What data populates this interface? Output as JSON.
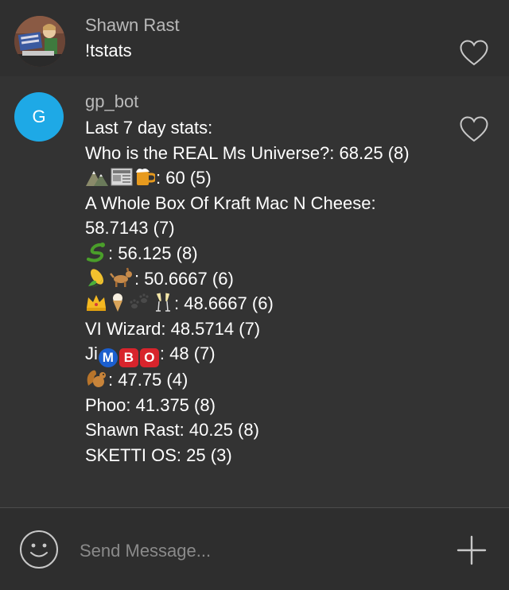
{
  "messages": [
    {
      "sender": "Shawn Rast",
      "lines": [
        "!tstats"
      ],
      "avatar": "photo-avatar",
      "liked": false
    },
    {
      "sender": "gp_bot",
      "avatar_letter": "G",
      "avatar_color": "#1ea9e6",
      "liked": false,
      "stats_header": "Last 7 day stats:",
      "stats": [
        {
          "name": "Who is the REAL Ms Universe?",
          "score": "68.25",
          "count": "(8)"
        },
        {
          "name_icons": [
            "mountain-icon",
            "newspaper-icon",
            "beer-mug-icon"
          ],
          "score": "60",
          "count": "(5)"
        },
        {
          "name": "A Whole Box Of Kraft Mac N Cheese",
          "score": "58.7143",
          "count": "(7)"
        },
        {
          "name_icons": [
            "snake-icon"
          ],
          "score": "56.125",
          "count": "(8)"
        },
        {
          "name_icons": [
            "corn-icon",
            "dog-icon"
          ],
          "score": "50.6667",
          "count": "(6)"
        },
        {
          "name_icons": [
            "crown-icon",
            "ice-cream-icon",
            "paw-prints-icon",
            "champagne-icon"
          ],
          "score": "48.6667",
          "count": "(6)"
        },
        {
          "name": "VI Wizard",
          "score": "48.5714",
          "count": "(7)"
        },
        {
          "name_prefix": "Ji",
          "badges": [
            "M",
            "B",
            "O"
          ],
          "score": "48",
          "count": "(7)"
        },
        {
          "name_icons": [
            "squirrel-icon"
          ],
          "score": "47.75",
          "count": "(4)"
        },
        {
          "name": "Phoo",
          "score": "41.375",
          "count": "(8)"
        },
        {
          "name": "Shawn Rast",
          "score": "40.25",
          "count": "(8)"
        },
        {
          "name": "SKETTI OS",
          "score": "25",
          "count": "(3)"
        }
      ]
    }
  ],
  "composer": {
    "placeholder": "Send Message...",
    "emoji_button_icon": "smiley-icon",
    "add_button_icon": "plus-icon"
  },
  "colors": {
    "background": "#333333",
    "avatar_blue": "#1ea9e6",
    "sender_name": "#b9b9b9",
    "text": "#ffffff"
  }
}
